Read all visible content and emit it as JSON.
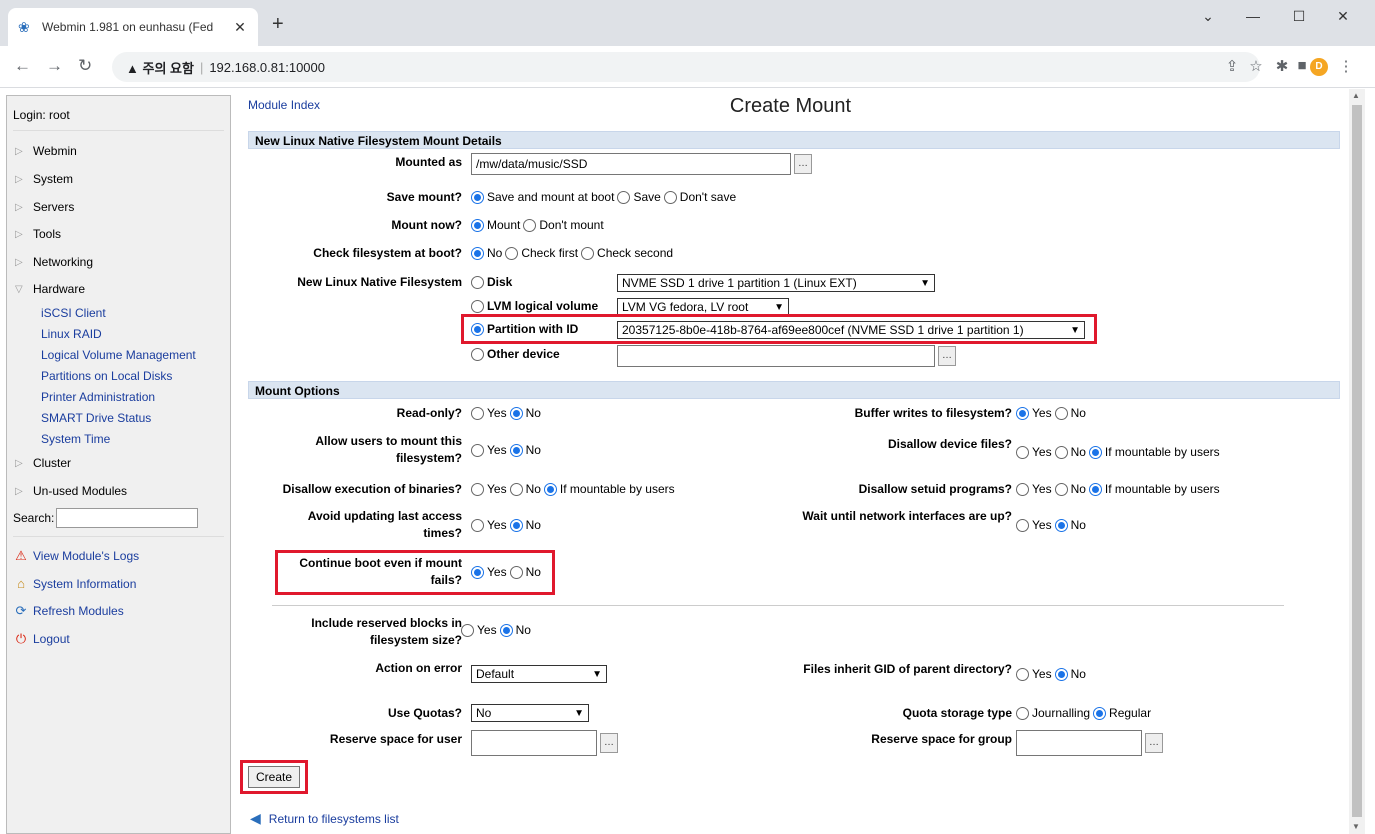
{
  "browser": {
    "tab_title": "Webmin 1.981 on eunhasu (Fed",
    "security_warning": "▲ 주의 요함",
    "url": "192.168.0.81:10000",
    "profile_initial": "D"
  },
  "sidebar": {
    "login": "Login: root",
    "categories": [
      "Webmin",
      "System",
      "Servers",
      "Tools",
      "Networking",
      "Hardware",
      "Cluster",
      "Un-used Modules"
    ],
    "hardware_items": [
      "iSCSI Client",
      "Linux RAID",
      "Logical Volume Management",
      "Partitions on Local Disks",
      "Printer Administration",
      "SMART Drive Status",
      "System Time"
    ],
    "search_label": "Search:",
    "links": [
      "View Module's Logs",
      "System Information",
      "Refresh Modules",
      "Logout"
    ]
  },
  "page": {
    "module_index": "Module Index",
    "title": "Create Mount",
    "section1": "New Linux Native Filesystem Mount Details",
    "section2": "Mount Options"
  },
  "details": {
    "mounted_as_label": "Mounted as",
    "mounted_as_value": "/mw/data/music/SSD",
    "save_mount_label": "Save mount?",
    "save_mount_opts": [
      "Save and mount at boot",
      "Save",
      "Don't save"
    ],
    "mount_now_label": "Mount now?",
    "mount_now_opts": [
      "Mount",
      "Don't mount"
    ],
    "check_fs_label": "Check filesystem at boot?",
    "check_fs_opts": [
      "No",
      "Check first",
      "Check second"
    ],
    "fs_label": "New Linux Native Filesystem",
    "disk_label": "Disk",
    "disk_value": "NVME SSD 1 drive 1 partition 1 (Linux EXT)",
    "lvm_label": "LVM logical volume",
    "lvm_value": "LVM VG fedora, LV root",
    "partid_label": "Partition with ID",
    "partid_value": "20357125-8b0e-418b-8764-af69ee800cef (NVME SSD 1 drive 1 partition 1)",
    "other_label": "Other device"
  },
  "options": {
    "readonly_label": "Read-only?",
    "allow_users_label": "Allow users to mount this filesystem?",
    "disallow_exec_label": "Disallow execution of binaries?",
    "avoid_atime_label": "Avoid updating last access times?",
    "continue_boot_label": "Continue boot even if mount fails?",
    "buffer_writes_label": "Buffer writes to filesystem?",
    "disallow_dev_label": "Disallow device files?",
    "disallow_suid_label": "Disallow setuid programs?",
    "wait_net_label": "Wait until network interfaces are up?",
    "reserved_blocks_label": "Include reserved blocks in filesystem size?",
    "action_error_label": "Action on error",
    "action_error_value": "Default",
    "inherit_gid_label": "Files inherit GID of parent directory?",
    "use_quotas_label": "Use Quotas?",
    "use_quotas_value": "No",
    "quota_storage_label": "Quota storage type",
    "quota_opts": [
      "Journalling",
      "Regular"
    ],
    "reserve_user_label": "Reserve space for user",
    "reserve_group_label": "Reserve space for group",
    "yes": "Yes",
    "no": "No",
    "if_mountable": "If mountable by users"
  },
  "footer": {
    "create_button": "Create",
    "return_link": "Return to filesystems list"
  },
  "icons": [
    "webmin-favicon-icon",
    "back-icon",
    "forward-icon",
    "reload-icon",
    "share-icon",
    "star-icon",
    "extensions-icon",
    "sidepanel-icon",
    "menu-icon",
    "triangle-icon",
    "warning-icon",
    "home-icon",
    "refresh-icon",
    "power-icon",
    "return-arrow-icon"
  ],
  "colors": {
    "highlight": "#e0182d",
    "section_bg": "#dbe5f1",
    "link": "#1a3d9e",
    "radio": "#1a73e8"
  }
}
